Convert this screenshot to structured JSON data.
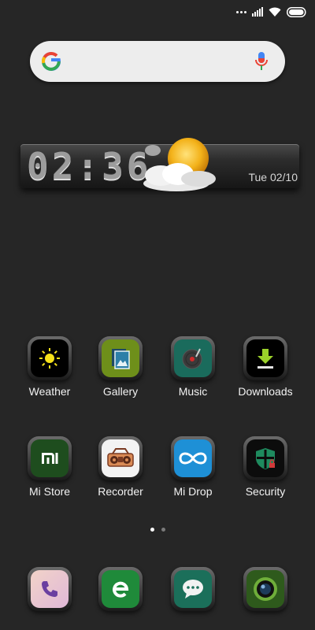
{
  "status_bar": {
    "icons": [
      "more-dots-icon",
      "signal-icon",
      "wifi-icon",
      "battery-icon"
    ]
  },
  "search": {
    "placeholder": "",
    "left_icon": "google-logo-icon",
    "right_icon": "microphone-icon"
  },
  "clock_widget": {
    "time": "02:36",
    "date": "Tue 02/10",
    "weather_icon": "sun-cloud-icon"
  },
  "apps": [
    {
      "label": "Weather",
      "icon": "weather-icon",
      "color": "#000000"
    },
    {
      "label": "Gallery",
      "icon": "gallery-icon",
      "color": "#6e8f1a"
    },
    {
      "label": "Music",
      "icon": "music-icon",
      "color": "#1a6b5c"
    },
    {
      "label": "Downloads",
      "icon": "downloads-icon",
      "color": "#000000"
    },
    {
      "label": "Mi Store",
      "icon": "mi-store-icon",
      "color": "#1e4d1e"
    },
    {
      "label": "Recorder",
      "icon": "recorder-icon",
      "color": "#f3f3f3"
    },
    {
      "label": "Mi Drop",
      "icon": "mi-drop-icon",
      "color": "#1e90d6"
    },
    {
      "label": "Security",
      "icon": "security-icon",
      "color": "#0c0c0c"
    }
  ],
  "dock": [
    {
      "icon": "phone-icon",
      "color": "#e9c9d2"
    },
    {
      "icon": "browser-icon",
      "color": "#1f8a3a"
    },
    {
      "icon": "messaging-icon",
      "color": "#1b6f5a"
    },
    {
      "icon": "camera-icon",
      "color": "#2e5a1c"
    }
  ],
  "page_indicator": {
    "pages": 2,
    "current": 1
  }
}
